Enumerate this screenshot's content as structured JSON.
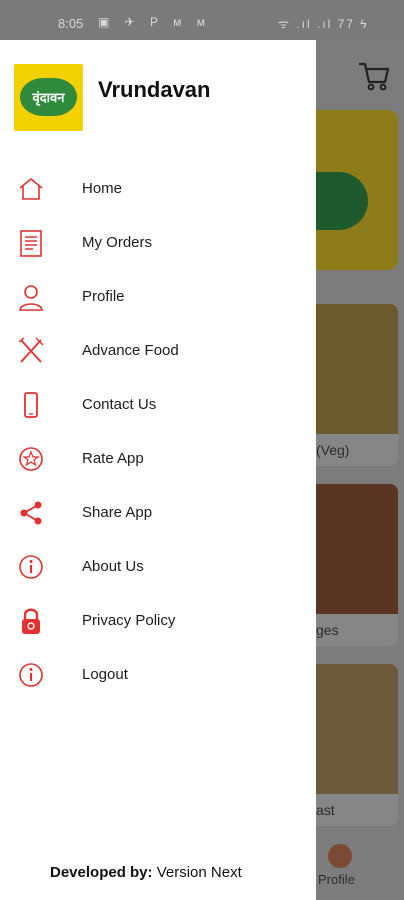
{
  "status_bar": {
    "time": "8:05",
    "notif_icons": "▣ ✈ P ᴍ ᴍ",
    "right": "ᯤ .ıl .ıl 77 ϟ"
  },
  "drawer": {
    "logo_text": "वृंदावन",
    "app_name": "Vrundavan",
    "menu": [
      {
        "label": "Home",
        "icon": "home-icon"
      },
      {
        "label": "My Orders",
        "icon": "orders-icon"
      },
      {
        "label": "Profile",
        "icon": "profile-icon"
      },
      {
        "label": "Advance Food",
        "icon": "fork-knife-icon"
      },
      {
        "label": "Contact Us",
        "icon": "phone-icon"
      },
      {
        "label": "Rate App",
        "icon": "star-badge-icon"
      },
      {
        "label": "Share App",
        "icon": "share-icon"
      },
      {
        "label": "About Us",
        "icon": "info-icon"
      },
      {
        "label": "Privacy Policy",
        "icon": "lock-icon"
      },
      {
        "label": "Logout",
        "icon": "info-icon"
      }
    ],
    "footer": {
      "prefix": "Developed by:",
      "name": "Version Next"
    }
  },
  "background": {
    "card_labels": [
      "(Veg)",
      "ges",
      "ast"
    ],
    "bottom_nav_label": "Profile"
  },
  "colors": {
    "accent": "#e2312f",
    "logo_bg": "#f3d000",
    "logo_green": "#2f8a3c"
  }
}
